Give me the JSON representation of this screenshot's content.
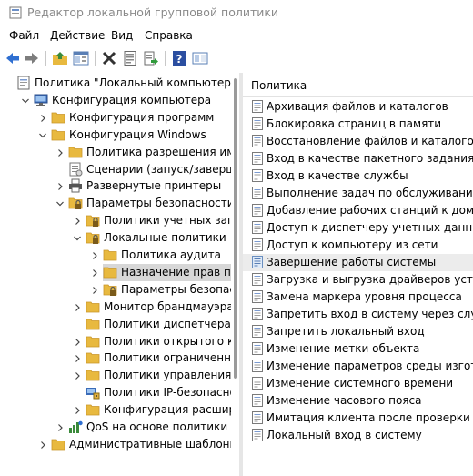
{
  "window": {
    "title": "Редактор локальной групповой политики"
  },
  "menu": [
    {
      "label": "Файл"
    },
    {
      "label": "Действие"
    },
    {
      "label": "Вид"
    },
    {
      "label": "Справка"
    }
  ],
  "toolbar": {
    "buttons": [
      "back-icon",
      "forward-icon",
      "up-folder-icon",
      "show-hide-tree-icon",
      "delete-icon",
      "properties-icon",
      "export-list-icon",
      "help-icon",
      "view-icon"
    ]
  },
  "tree": {
    "items": [
      {
        "label": "Политика \"Локальный компьютер\"",
        "icon": "policy-icon",
        "level": 0,
        "expander": "none"
      },
      {
        "label": "Конфигурация компьютера",
        "icon": "computer-icon",
        "level": 1,
        "expander": "expanded"
      },
      {
        "label": "Конфигурация программ",
        "icon": "folder-icon",
        "level": 2,
        "expander": "collapsed"
      },
      {
        "label": "Конфигурация Windows",
        "icon": "folder-icon",
        "level": 2,
        "expander": "expanded"
      },
      {
        "label": "Политика разрешения имен",
        "icon": "folder-icon",
        "level": 3,
        "expander": "collapsed"
      },
      {
        "label": "Сценарии (запуск/завершени",
        "icon": "scripts-icon",
        "level": 3,
        "expander": "none"
      },
      {
        "label": "Развернутые принтеры",
        "icon": "printer-icon",
        "level": 3,
        "expander": "collapsed"
      },
      {
        "label": "Параметры безопасности",
        "icon": "security-folder-icon",
        "level": 3,
        "expander": "expanded"
      },
      {
        "label": "Политики учетных записе",
        "icon": "security-folder-icon",
        "level": 4,
        "expander": "collapsed"
      },
      {
        "label": "Локальные политики",
        "icon": "security-folder-icon",
        "level": 4,
        "expander": "expanded"
      },
      {
        "label": "Политика аудита",
        "icon": "folder-icon",
        "level": 5,
        "expander": "collapsed"
      },
      {
        "label": "Назначение прав польз",
        "icon": "folder-icon",
        "level": 5,
        "expander": "collapsed",
        "selected": true
      },
      {
        "label": "Параметры безопасно",
        "icon": "security-folder-icon",
        "level": 5,
        "expander": "collapsed"
      },
      {
        "label": "Монитор брандмауэра За",
        "icon": "folder-icon",
        "level": 4,
        "expander": "collapsed"
      },
      {
        "label": "Политики диспетчера спи",
        "icon": "folder-icon",
        "level": 4,
        "expander": "none"
      },
      {
        "label": "Политики открытого ключ",
        "icon": "folder-icon",
        "level": 4,
        "expander": "collapsed"
      },
      {
        "label": "Политики ограниченного",
        "icon": "folder-icon",
        "level": 4,
        "expander": "collapsed"
      },
      {
        "label": "Политики управления при",
        "icon": "folder-icon",
        "level": 4,
        "expander": "collapsed"
      },
      {
        "label": "Политики IP-безопасности",
        "icon": "ipsec-icon",
        "level": 4,
        "expander": "none"
      },
      {
        "label": "Конфигурация расширени",
        "icon": "folder-icon",
        "level": 4,
        "expander": "collapsed"
      },
      {
        "label": "QoS на основе политики",
        "icon": "qos-icon",
        "level": 3,
        "expander": "collapsed"
      },
      {
        "label": "Административные шаблоны",
        "icon": "folder-icon",
        "level": 2,
        "expander": "collapsed"
      }
    ]
  },
  "policies": {
    "header": "Политика",
    "items": [
      "Архивация файлов и каталогов",
      "Блокировка страниц в памяти",
      "Восстановление файлов и каталогов",
      "Вход в качестве пакетного задания",
      "Вход в качестве службы",
      "Выполнение задач по обслуживанию том",
      "Добавление рабочих станций к домену",
      "Доступ к диспетчеру учетных данных от и",
      "Доступ к компьютеру из сети",
      "Завершение работы системы",
      "Загрузка и выгрузка драйверов устройст",
      "Замена маркера уровня процесса",
      "Запретить вход в систему через службу у",
      "Запретить локальный вход",
      "Изменение метки объекта",
      "Изменение параметров среды изготовит",
      "Изменение системного времени",
      "Изменение часового пояса",
      "Имитация клиента после проверки подли",
      "Локальный вход в систему"
    ],
    "highlighted_index": 9
  },
  "colors": {
    "folder": "#e8b93f",
    "folder_dark": "#c9952a",
    "selection": "#d7d7d7",
    "scrollbar_thumb": "#9a9a9a"
  }
}
